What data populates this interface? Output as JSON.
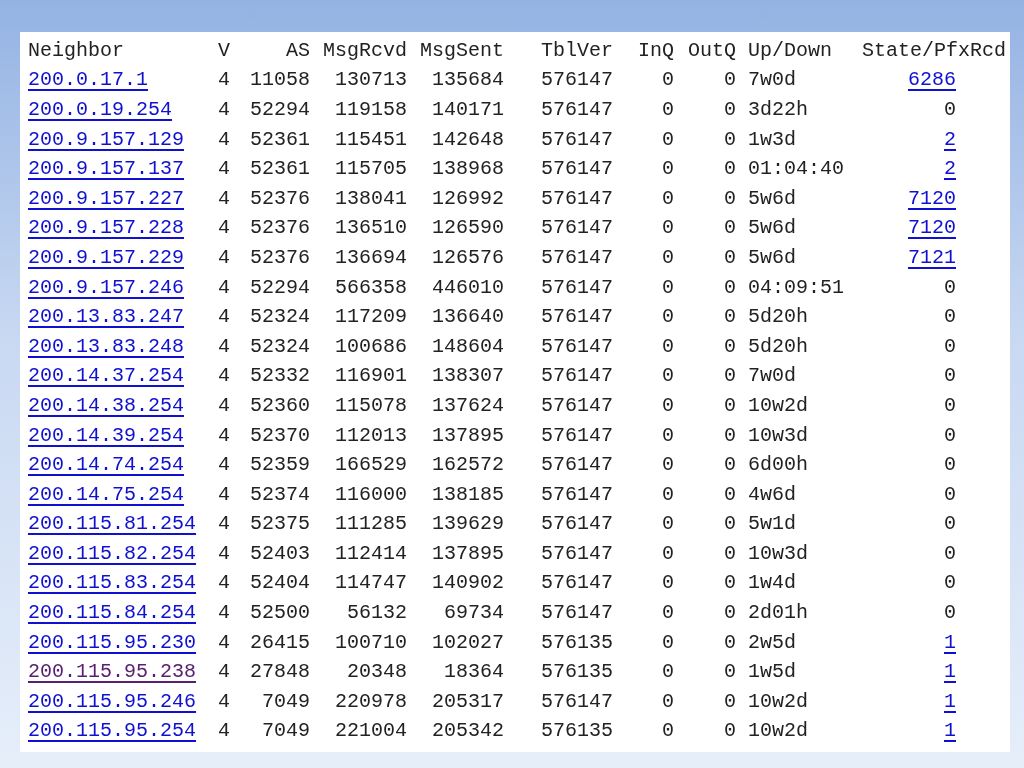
{
  "columns": [
    "Neighbor",
    "V",
    "AS",
    "MsgRcvd",
    "MsgSent",
    "TblVer",
    "InQ",
    "OutQ",
    "Up/Down",
    "State/PfxRcd"
  ],
  "rows": [
    {
      "neighbor": "200.0.17.1",
      "visited": false,
      "v": "4",
      "as": "11058",
      "msg_rcvd": "130713",
      "msg_sent": "135684",
      "tbl_ver": "576147",
      "inq": "0",
      "outq": "0",
      "up_down": "7w0d",
      "pfx_rcd": "6286",
      "pfx_linked": true
    },
    {
      "neighbor": "200.0.19.254",
      "visited": false,
      "v": "4",
      "as": "52294",
      "msg_rcvd": "119158",
      "msg_sent": "140171",
      "tbl_ver": "576147",
      "inq": "0",
      "outq": "0",
      "up_down": "3d22h",
      "pfx_rcd": "0",
      "pfx_linked": false
    },
    {
      "neighbor": "200.9.157.129",
      "visited": false,
      "v": "4",
      "as": "52361",
      "msg_rcvd": "115451",
      "msg_sent": "142648",
      "tbl_ver": "576147",
      "inq": "0",
      "outq": "0",
      "up_down": "1w3d",
      "pfx_rcd": "2",
      "pfx_linked": true
    },
    {
      "neighbor": "200.9.157.137",
      "visited": false,
      "v": "4",
      "as": "52361",
      "msg_rcvd": "115705",
      "msg_sent": "138968",
      "tbl_ver": "576147",
      "inq": "0",
      "outq": "0",
      "up_down": "01:04:40",
      "pfx_rcd": "2",
      "pfx_linked": true
    },
    {
      "neighbor": "200.9.157.227",
      "visited": false,
      "v": "4",
      "as": "52376",
      "msg_rcvd": "138041",
      "msg_sent": "126992",
      "tbl_ver": "576147",
      "inq": "0",
      "outq": "0",
      "up_down": "5w6d",
      "pfx_rcd": "7120",
      "pfx_linked": true
    },
    {
      "neighbor": "200.9.157.228",
      "visited": false,
      "v": "4",
      "as": "52376",
      "msg_rcvd": "136510",
      "msg_sent": "126590",
      "tbl_ver": "576147",
      "inq": "0",
      "outq": "0",
      "up_down": "5w6d",
      "pfx_rcd": "7120",
      "pfx_linked": true
    },
    {
      "neighbor": "200.9.157.229",
      "visited": false,
      "v": "4",
      "as": "52376",
      "msg_rcvd": "136694",
      "msg_sent": "126576",
      "tbl_ver": "576147",
      "inq": "0",
      "outq": "0",
      "up_down": "5w6d",
      "pfx_rcd": "7121",
      "pfx_linked": true
    },
    {
      "neighbor": "200.9.157.246",
      "visited": false,
      "v": "4",
      "as": "52294",
      "msg_rcvd": "566358",
      "msg_sent": "446010",
      "tbl_ver": "576147",
      "inq": "0",
      "outq": "0",
      "up_down": "04:09:51",
      "pfx_rcd": "0",
      "pfx_linked": false
    },
    {
      "neighbor": "200.13.83.247",
      "visited": false,
      "v": "4",
      "as": "52324",
      "msg_rcvd": "117209",
      "msg_sent": "136640",
      "tbl_ver": "576147",
      "inq": "0",
      "outq": "0",
      "up_down": "5d20h",
      "pfx_rcd": "0",
      "pfx_linked": false
    },
    {
      "neighbor": "200.13.83.248",
      "visited": false,
      "v": "4",
      "as": "52324",
      "msg_rcvd": "100686",
      "msg_sent": "148604",
      "tbl_ver": "576147",
      "inq": "0",
      "outq": "0",
      "up_down": "5d20h",
      "pfx_rcd": "0",
      "pfx_linked": false
    },
    {
      "neighbor": "200.14.37.254",
      "visited": false,
      "v": "4",
      "as": "52332",
      "msg_rcvd": "116901",
      "msg_sent": "138307",
      "tbl_ver": "576147",
      "inq": "0",
      "outq": "0",
      "up_down": "7w0d",
      "pfx_rcd": "0",
      "pfx_linked": false
    },
    {
      "neighbor": "200.14.38.254",
      "visited": false,
      "v": "4",
      "as": "52360",
      "msg_rcvd": "115078",
      "msg_sent": "137624",
      "tbl_ver": "576147",
      "inq": "0",
      "outq": "0",
      "up_down": "10w2d",
      "pfx_rcd": "0",
      "pfx_linked": false
    },
    {
      "neighbor": "200.14.39.254",
      "visited": false,
      "v": "4",
      "as": "52370",
      "msg_rcvd": "112013",
      "msg_sent": "137895",
      "tbl_ver": "576147",
      "inq": "0",
      "outq": "0",
      "up_down": "10w3d",
      "pfx_rcd": "0",
      "pfx_linked": false
    },
    {
      "neighbor": "200.14.74.254",
      "visited": false,
      "v": "4",
      "as": "52359",
      "msg_rcvd": "166529",
      "msg_sent": "162572",
      "tbl_ver": "576147",
      "inq": "0",
      "outq": "0",
      "up_down": "6d00h",
      "pfx_rcd": "0",
      "pfx_linked": false
    },
    {
      "neighbor": "200.14.75.254",
      "visited": false,
      "v": "4",
      "as": "52374",
      "msg_rcvd": "116000",
      "msg_sent": "138185",
      "tbl_ver": "576147",
      "inq": "0",
      "outq": "0",
      "up_down": "4w6d",
      "pfx_rcd": "0",
      "pfx_linked": false
    },
    {
      "neighbor": "200.115.81.254",
      "visited": false,
      "v": "4",
      "as": "52375",
      "msg_rcvd": "111285",
      "msg_sent": "139629",
      "tbl_ver": "576147",
      "inq": "0",
      "outq": "0",
      "up_down": "5w1d",
      "pfx_rcd": "0",
      "pfx_linked": false
    },
    {
      "neighbor": "200.115.82.254",
      "visited": false,
      "v": "4",
      "as": "52403",
      "msg_rcvd": "112414",
      "msg_sent": "137895",
      "tbl_ver": "576147",
      "inq": "0",
      "outq": "0",
      "up_down": "10w3d",
      "pfx_rcd": "0",
      "pfx_linked": false
    },
    {
      "neighbor": "200.115.83.254",
      "visited": false,
      "v": "4",
      "as": "52404",
      "msg_rcvd": "114747",
      "msg_sent": "140902",
      "tbl_ver": "576147",
      "inq": "0",
      "outq": "0",
      "up_down": "1w4d",
      "pfx_rcd": "0",
      "pfx_linked": false
    },
    {
      "neighbor": "200.115.84.254",
      "visited": false,
      "v": "4",
      "as": "52500",
      "msg_rcvd": "56132",
      "msg_sent": "69734",
      "tbl_ver": "576147",
      "inq": "0",
      "outq": "0",
      "up_down": "2d01h",
      "pfx_rcd": "0",
      "pfx_linked": false
    },
    {
      "neighbor": "200.115.95.230",
      "visited": false,
      "v": "4",
      "as": "26415",
      "msg_rcvd": "100710",
      "msg_sent": "102027",
      "tbl_ver": "576135",
      "inq": "0",
      "outq": "0",
      "up_down": "2w5d",
      "pfx_rcd": "1",
      "pfx_linked": true
    },
    {
      "neighbor": "200.115.95.238",
      "visited": true,
      "v": "4",
      "as": "27848",
      "msg_rcvd": "20348",
      "msg_sent": "18364",
      "tbl_ver": "576135",
      "inq": "0",
      "outq": "0",
      "up_down": "1w5d",
      "pfx_rcd": "1",
      "pfx_linked": true
    },
    {
      "neighbor": "200.115.95.246",
      "visited": false,
      "v": "4",
      "as": "7049",
      "msg_rcvd": "220978",
      "msg_sent": "205317",
      "tbl_ver": "576147",
      "inq": "0",
      "outq": "0",
      "up_down": "10w2d",
      "pfx_rcd": "1",
      "pfx_linked": true
    },
    {
      "neighbor": "200.115.95.254",
      "visited": false,
      "v": "4",
      "as": "7049",
      "msg_rcvd": "221004",
      "msg_sent": "205342",
      "tbl_ver": "576135",
      "inq": "0",
      "outq": "0",
      "up_down": "10w2d",
      "pfx_rcd": "1",
      "pfx_linked": true
    }
  ]
}
